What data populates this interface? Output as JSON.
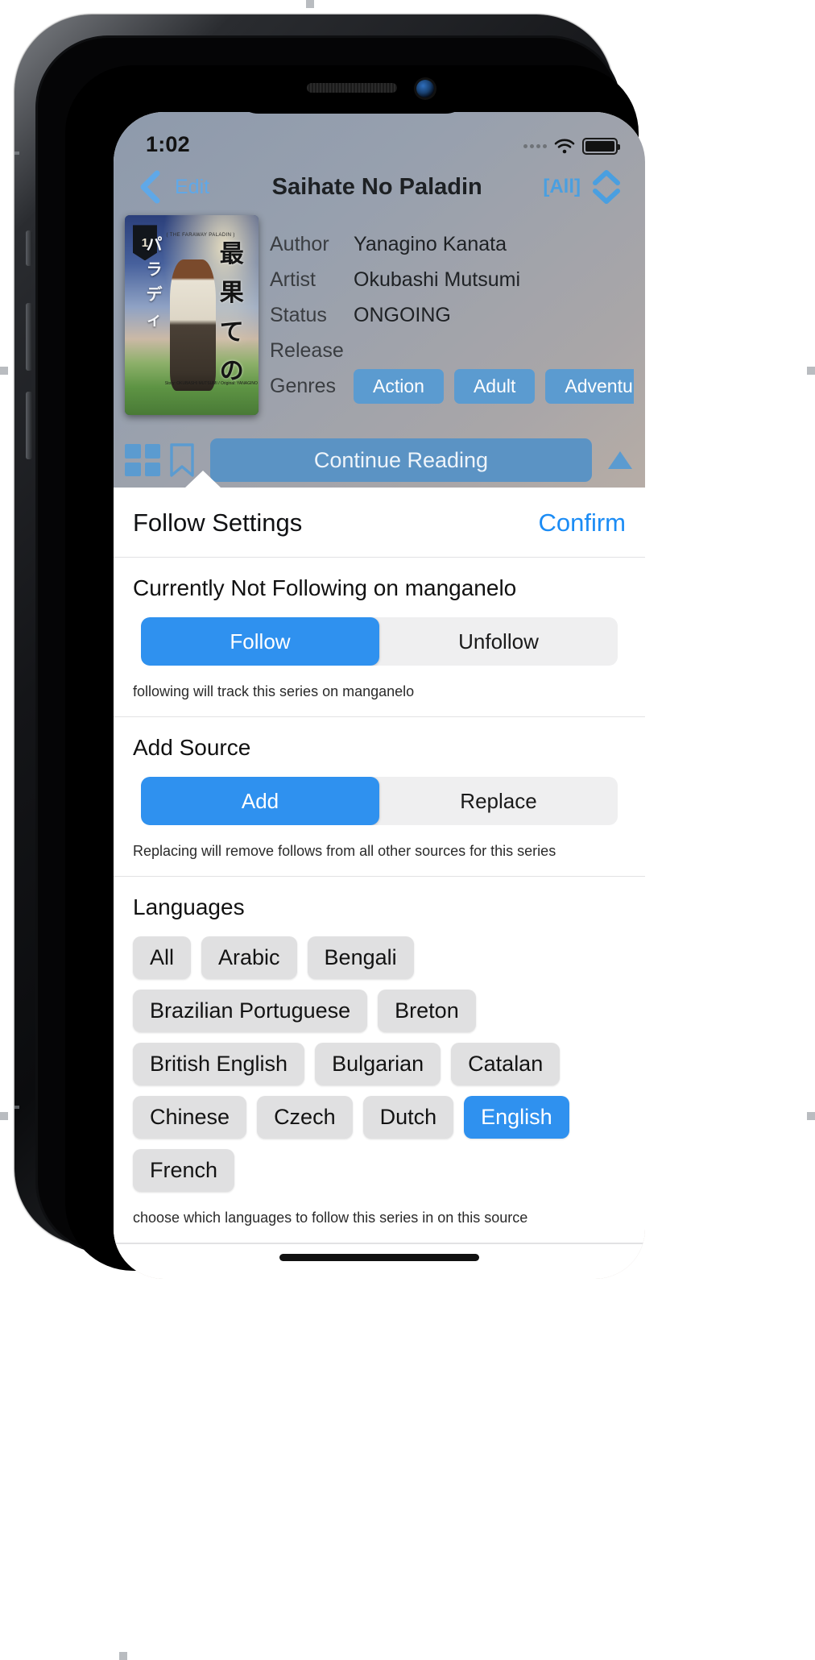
{
  "status_bar": {
    "time": "1:02",
    "signal_icon": "signal-dots-icon",
    "wifi_icon": "wifi-icon",
    "battery_icon": "battery-icon"
  },
  "nav_bar": {
    "back_icon": "chevron-left-icon",
    "edit_label": "Edit",
    "title": "Saihate No Paladin",
    "filter_label": "[All]",
    "stepper_icon": "chevron-up-down-icon"
  },
  "series": {
    "cover": {
      "volume_number": "1",
      "english_title": "( THE FARAWAY PALADIN )",
      "kanji_title": "最果ての",
      "katakana_title": "パラディン",
      "credits": "Story: OKUBASHI MUTSUMI / Original: YANAGINO KANATA / Character: SHIROTA"
    },
    "fields": [
      {
        "key": "Author",
        "value": "Yanagino Kanata"
      },
      {
        "key": "Artist",
        "value": "Okubashi Mutsumi"
      },
      {
        "key": "Status",
        "value": "ONGOING"
      },
      {
        "key": "Release",
        "value": ""
      }
    ],
    "genres_label": "Genres",
    "genres": [
      "Action",
      "Adult",
      "Adventu"
    ]
  },
  "action_bar": {
    "grid_icon": "grid-view-icon",
    "bookmark_icon": "bookmark-icon",
    "continue_label": "Continue Reading",
    "collapse_icon": "triangle-up-icon"
  },
  "sheet": {
    "title": "Follow Settings",
    "confirm_label": "Confirm",
    "follow_section": {
      "title": "Currently Not Following on  manganelo",
      "options": [
        {
          "label": "Follow",
          "selected": true
        },
        {
          "label": "Unfollow",
          "selected": false
        }
      ],
      "hint": "following will track this series on manganelo"
    },
    "source_section": {
      "title": "Add Source",
      "options": [
        {
          "label": "Add",
          "selected": true
        },
        {
          "label": "Replace",
          "selected": false
        }
      ],
      "hint": "Replacing will remove follows from all other sources for this series"
    },
    "languages_section": {
      "title": "Languages",
      "chips": [
        {
          "label": "All",
          "selected": false
        },
        {
          "label": "Arabic",
          "selected": false
        },
        {
          "label": "Bengali",
          "selected": false
        },
        {
          "label": "Brazilian Portuguese",
          "selected": false
        },
        {
          "label": "Breton",
          "selected": false
        },
        {
          "label": "British English",
          "selected": false
        },
        {
          "label": "Bulgarian",
          "selected": false
        },
        {
          "label": "Catalan",
          "selected": false
        },
        {
          "label": "Chinese",
          "selected": false
        },
        {
          "label": "Czech",
          "selected": false
        },
        {
          "label": "Dutch",
          "selected": false
        },
        {
          "label": "English",
          "selected": true
        },
        {
          "label": "French",
          "selected": false
        }
      ],
      "hint": "choose which languages to follow this series in on this source"
    }
  },
  "colors": {
    "accent_blue": "#2f91ef",
    "link_blue": "#1b8cf5",
    "muted_blue": "#5b9bd0",
    "chip_grey": "#e0e0e1"
  }
}
